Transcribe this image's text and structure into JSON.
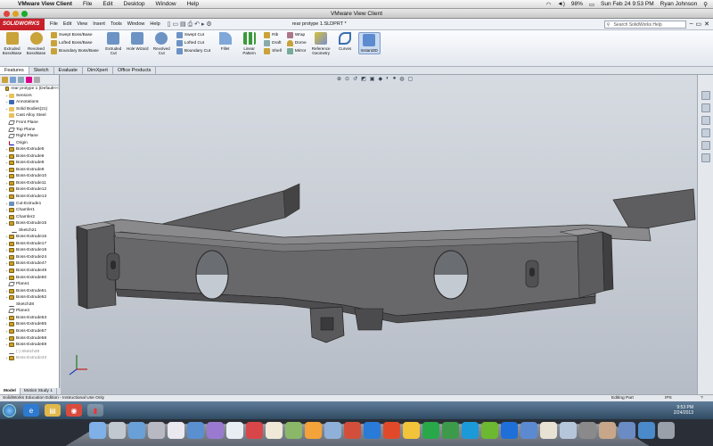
{
  "mac": {
    "app": "VMware View Client",
    "menus": [
      "File",
      "Edit",
      "Desktop",
      "Window",
      "Help"
    ],
    "battery": "98%",
    "datetime": "Sun Feb 24  9:53 PM",
    "user": "Ryan Johnson"
  },
  "vm_title": "VMware View Client",
  "sw": {
    "logo": "SOLIDWORKS",
    "menus": [
      "File",
      "Edit",
      "View",
      "Insert",
      "Tools",
      "Window",
      "Help"
    ],
    "doc_title": "rear protype 1.SLDPRT *",
    "search_placeholder": "Search SolidWorks Help"
  },
  "commands": {
    "big": [
      {
        "label": "Extruded Boss/Base",
        "color": "#c9a23a"
      },
      {
        "label": "Revolved Boss/Base",
        "color": "#c9a23a"
      }
    ],
    "boss_small": [
      "Swept Boss/Base",
      "Lofted Boss/Base",
      "Boundary Boss/Base"
    ],
    "cut_big": [
      {
        "label": "Extruded Cut",
        "color": "#6d93c4"
      },
      {
        "label": "Hole Wizard",
        "color": "#6d93c4"
      },
      {
        "label": "Revolved Cut",
        "color": "#6d93c4"
      }
    ],
    "cut_small": [
      "Swept Cut",
      "Lofted Cut",
      "Boundary Cut"
    ],
    "fillet": "Fillet",
    "linear_pattern": "Linear Pattern",
    "feat_small1": [
      "Rib",
      "Draft",
      "Shell"
    ],
    "feat_small2": [
      "Wrap",
      "Dome",
      "Mirror"
    ],
    "ref_geometry": "Reference Geometry",
    "curves": "Curves",
    "instant3d": "Instant3D"
  },
  "tabs": [
    "Features",
    "Sketch",
    "Evaluate",
    "DimXpert",
    "Office Products"
  ],
  "tree": {
    "items": [
      {
        "label": "rear protype 1  (Default<<",
        "icon": "part",
        "level": 0
      },
      {
        "label": "Sensors",
        "icon": "folder",
        "level": 1
      },
      {
        "label": "Annotations",
        "icon": "annot",
        "level": 1
      },
      {
        "label": "Solid Bodies(21)",
        "icon": "folder",
        "level": 1
      },
      {
        "label": "Cast Alloy Steel",
        "icon": "material",
        "level": 1
      },
      {
        "label": "Front Plane",
        "icon": "plane",
        "level": 1
      },
      {
        "label": "Top Plane",
        "icon": "plane",
        "level": 1
      },
      {
        "label": "Right Plane",
        "icon": "plane",
        "level": 1
      },
      {
        "label": "Origin",
        "icon": "origin",
        "level": 1
      },
      {
        "label": "Boss-Extrude5",
        "icon": "boss",
        "level": 1
      },
      {
        "label": "Boss-Extrude6",
        "icon": "boss",
        "level": 1
      },
      {
        "label": "Boss-Extrude8",
        "icon": "boss",
        "level": 1
      },
      {
        "label": "Boss-Extrude9",
        "icon": "boss",
        "level": 1
      },
      {
        "label": "Boss-Extrude10",
        "icon": "boss",
        "level": 1
      },
      {
        "label": "Boss-Extrude11",
        "icon": "boss",
        "level": 1
      },
      {
        "label": "Boss-Extrude12",
        "icon": "boss",
        "level": 1
      },
      {
        "label": "Boss-Extrude13",
        "icon": "boss",
        "level": 1
      },
      {
        "label": "Cut-Extrude1",
        "icon": "cut",
        "level": 1
      },
      {
        "label": "Chamfer1",
        "icon": "boss",
        "level": 1
      },
      {
        "label": "Chamfer2",
        "icon": "boss",
        "level": 1
      },
      {
        "label": "Boss-Extrude15",
        "icon": "boss",
        "level": 1
      },
      {
        "label": "Sketch21",
        "icon": "sketch",
        "level": 2
      },
      {
        "label": "Boss-Extrude16",
        "icon": "boss",
        "level": 1
      },
      {
        "label": "Boss-Extrude17",
        "icon": "boss",
        "level": 1
      },
      {
        "label": "Boss-Extrude18",
        "icon": "boss",
        "level": 1
      },
      {
        "label": "Boss-Extrude24",
        "icon": "boss",
        "level": 1
      },
      {
        "label": "Boss-Extrude47",
        "icon": "boss",
        "level": 1
      },
      {
        "label": "Boss-Extrude49",
        "icon": "boss",
        "level": 1
      },
      {
        "label": "Boss-Extrude50",
        "icon": "boss",
        "level": 1
      },
      {
        "label": "Plane1",
        "icon": "plane",
        "level": 1
      },
      {
        "label": "Boss-Extrude51",
        "icon": "boss",
        "level": 1
      },
      {
        "label": "Boss-Extrude52",
        "icon": "boss",
        "level": 1
      },
      {
        "label": "Sketch38",
        "icon": "sketch",
        "level": 1
      },
      {
        "label": "Plane3",
        "icon": "plane",
        "level": 1
      },
      {
        "label": "Boss-Extrude53",
        "icon": "boss",
        "level": 1
      },
      {
        "label": "Boss-Extrude55",
        "icon": "boss",
        "level": 1
      },
      {
        "label": "Boss-Extrude57",
        "icon": "boss",
        "level": 1
      },
      {
        "label": "Boss-Extrude58",
        "icon": "boss",
        "level": 1
      },
      {
        "label": "Boss-Extrude59",
        "icon": "boss",
        "level": 1
      },
      {
        "label": "(-) Sketch28",
        "icon": "sketch",
        "level": 1,
        "grey": true
      },
      {
        "label": "Boss-Extrude33",
        "icon": "boss",
        "level": 1,
        "grey": true
      }
    ]
  },
  "tree_tabs": [
    "Model",
    "Motion Study 1"
  ],
  "status": {
    "left": "SolidWorks Education Edition - Instructional Use Only",
    "mode": "Editing Part",
    "units": "IPS",
    "help": "?"
  },
  "taskbar": {
    "time": "9:53 PM",
    "date": "2/24/2013"
  }
}
